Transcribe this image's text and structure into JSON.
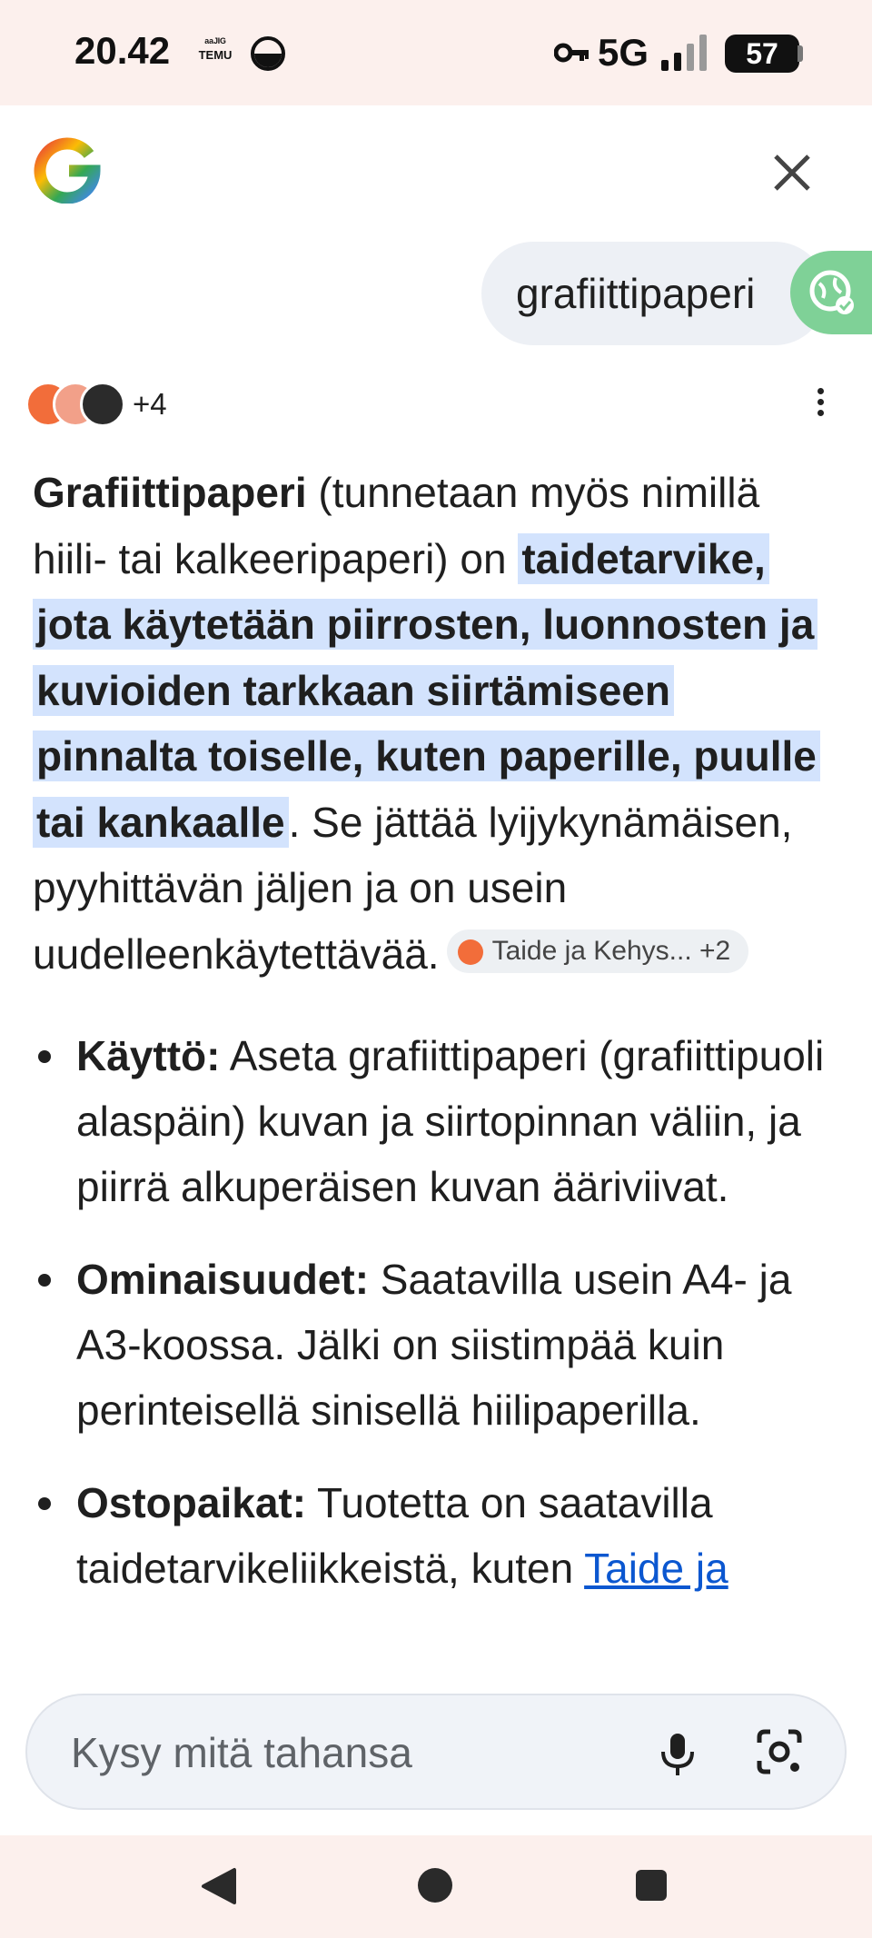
{
  "status_bar": {
    "time": "20.42",
    "temu_line1": "ᵃᵃᴶᴵᴳ",
    "temu_line2": "TEMU",
    "network": "5G",
    "battery": "57"
  },
  "query": {
    "text": "grafiittipaperi"
  },
  "sources": {
    "count_label": "+4"
  },
  "answer": {
    "term": "Grafiittipaperi",
    "intro": " (tunnetaan myös nimillä hiili- tai kalkeeripaperi) on ",
    "highlight": "taidetarvike, jota käytetään piirrosten, luonnosten ja kuvioiden tarkkaan siirtämiseen pinnalta toiselle, kuten paperille, puulle tai kankaalle",
    "rest": ". Se jättää lyijykynämäisen, pyyhittävän jäljen ja on usein uudelleenkäytettävää.",
    "chip_label": "Taide ja Kehys...",
    "chip_count": "+2"
  },
  "bullets": [
    {
      "title": "Käyttö:",
      "text": " Aseta grafiittipaperi (grafiittipuoli alaspäin) kuvan ja siirtopinnan väliin, ja piirrä alkuperäisen kuvan ääriviivat."
    },
    {
      "title": "Ominaisuudet:",
      "text": " Saatavilla usein A4- ja A3-koossa. Jälki on siistimpää kuin perinteisellä sinisellä hiilipaperilla."
    },
    {
      "title": "Ostopaikat:",
      "text": " Tuotetta on saatavilla taidetarvikeliikkeistä, kuten ",
      "link": "Taide ja"
    }
  ],
  "input": {
    "placeholder": "Kysy mitä tahansa"
  },
  "icons": {
    "mic": "mic-icon",
    "lens": "lens-icon",
    "close": "close-icon",
    "translate": "translate-icon"
  },
  "colors": {
    "highlight": "#d3e3fd",
    "link": "#0b57d0",
    "system_bar": "#fcf0ed",
    "translate_button": "#7fd197"
  }
}
